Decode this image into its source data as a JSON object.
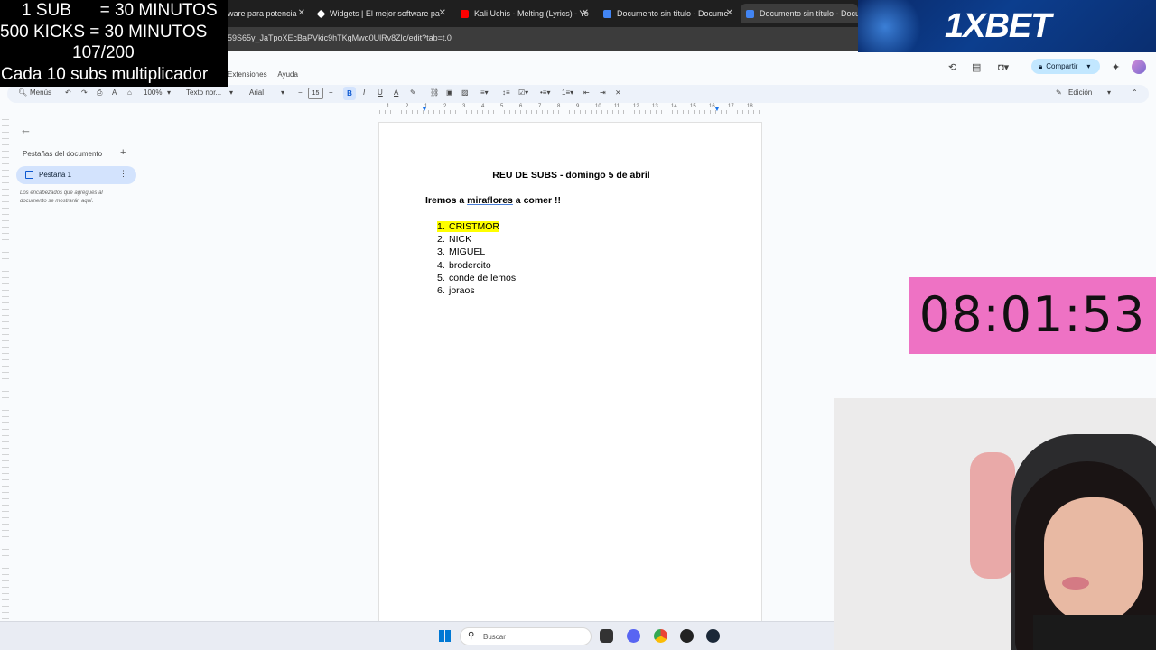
{
  "browser": {
    "tabs": [
      {
        "label": "ware para potencia",
        "active": false
      },
      {
        "label": "Widgets | El mejor software pa",
        "active": false
      },
      {
        "label": "Kali Uchis - Melting (Lyrics) - Yo",
        "active": false
      },
      {
        "label": "Documento sin título - Docume",
        "active": false
      },
      {
        "label": "Documento sin título - Docum",
        "active": true
      }
    ],
    "url": "59S65y_JaTpoXEcBaPVkic9hTKgMwo0UlRv8Zlc/edit?tab=t.0"
  },
  "docs": {
    "menu": [
      "Extensiones",
      "Ayuda"
    ],
    "share_label": "Compartir",
    "toolbar": {
      "menus_label": "Menús",
      "zoom": "100%",
      "style": "Texto nor...",
      "font": "Arial",
      "font_size": "15",
      "edit_mode": "Edición"
    },
    "ruler_numbers": [
      "1",
      "2",
      "1",
      "2",
      "3",
      "4",
      "5",
      "6",
      "7",
      "8",
      "9",
      "10",
      "11",
      "12",
      "13",
      "14",
      "15",
      "16",
      "17",
      "18"
    ]
  },
  "outline": {
    "title": "Pestañas del documento",
    "tab_label": "Pestaña 1",
    "hint": "Los encabezados que agregues al documento se mostrarán aquí."
  },
  "document": {
    "title": "REU DE SUBS - domingo 5 de abril",
    "subtitle_pre": "Iremos a ",
    "subtitle_underlined": "miraflores",
    "subtitle_post": " a comer !!",
    "list": [
      {
        "num": "1.",
        "text": "CRISTMOR",
        "highlighted": true
      },
      {
        "num": "2.",
        "text": "NICK",
        "highlighted": false
      },
      {
        "num": "3.",
        "text": "MIGUEL",
        "highlighted": false
      },
      {
        "num": "4.",
        "text": "brodercito",
        "highlighted": false
      },
      {
        "num": "5.",
        "text": "conde de lemos",
        "highlighted": false
      },
      {
        "num": "6.",
        "text": "joraos",
        "highlighted": false
      }
    ]
  },
  "overlay": {
    "line1": "1 SUB      = 30 MINUTOS",
    "line2": "500 KICKS = 30 MINUTOS",
    "line3": "107/200",
    "line4": "Cada 10 subs multiplicador",
    "sponsor": "1XBET",
    "timer": "08:01:53"
  },
  "taskbar": {
    "search_label": "Buscar"
  },
  "colors": {
    "highlight": "#ffff00",
    "timer_bg": "#ee72c4",
    "share_bg": "#c2e7ff",
    "sponsor_bg": "#0c3e8e"
  }
}
